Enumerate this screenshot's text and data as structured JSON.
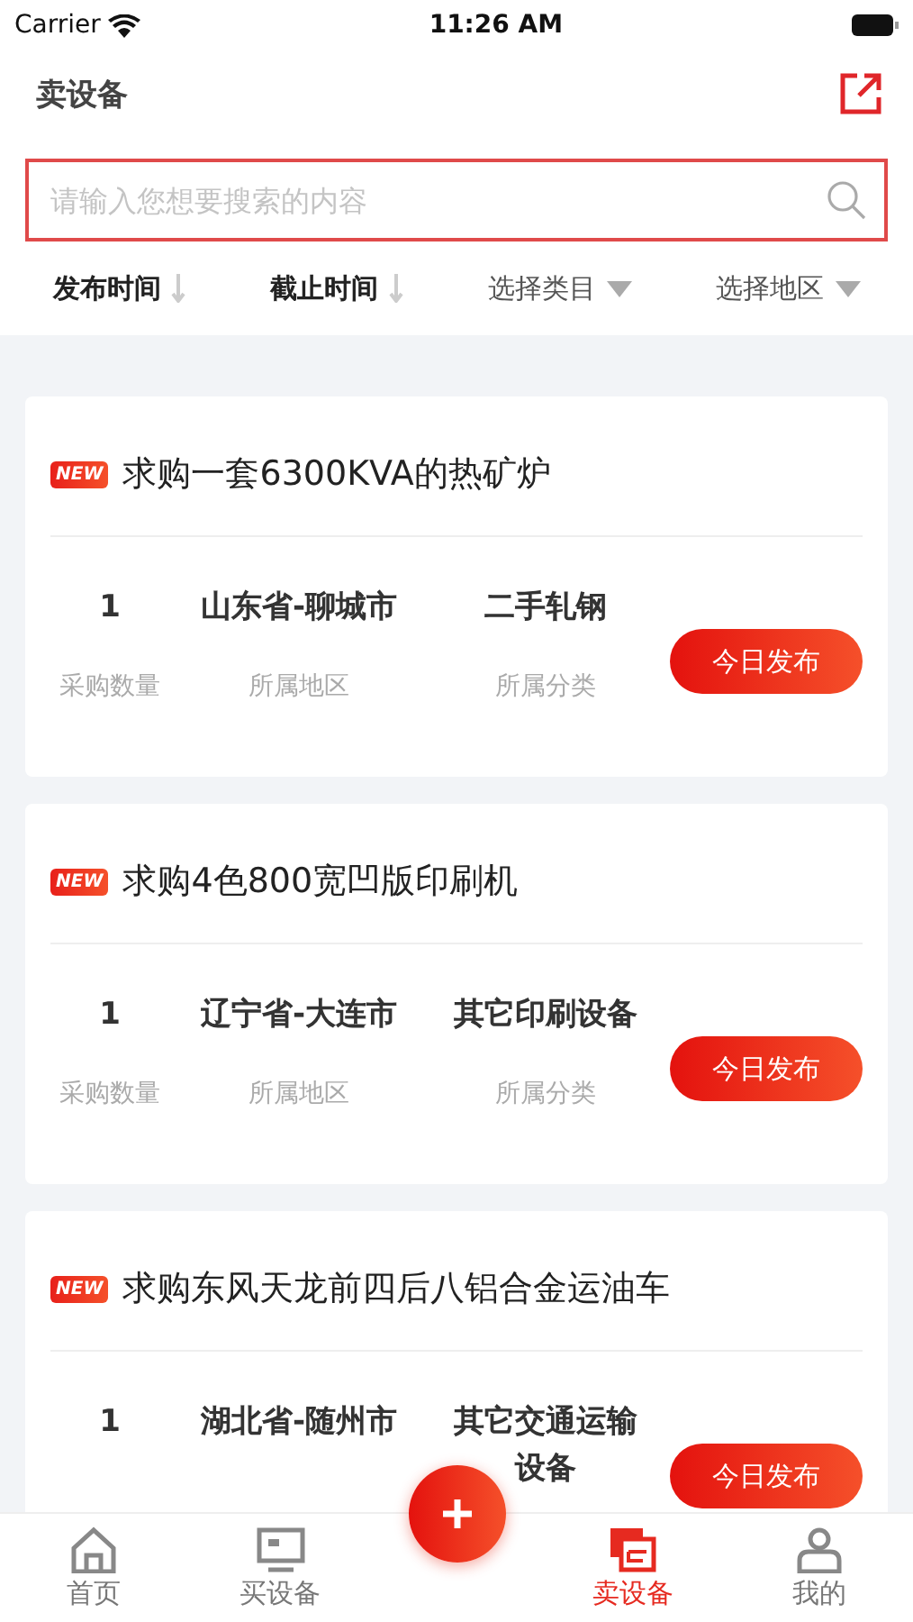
{
  "status_bar": {
    "carrier": "Carrier",
    "time": "11:26 AM"
  },
  "header": {
    "title": "卖设备"
  },
  "search": {
    "placeholder": "请输入您想要搜索的内容"
  },
  "filters": [
    {
      "label": "发布时间",
      "kind": "sort"
    },
    {
      "label": "截止时间",
      "kind": "sort"
    },
    {
      "label": "选择类目",
      "kind": "select"
    },
    {
      "label": "选择地区",
      "kind": "select"
    }
  ],
  "cards": [
    {
      "badge": "NEW",
      "title": "求购一套6300KVA的热矿炉",
      "quantity": "1",
      "region": "山东省-聊城市",
      "category": "二手轧钢",
      "labels": [
        "采购数量",
        "所属地区",
        "所属分类"
      ],
      "button": "今日发布"
    },
    {
      "badge": "NEW",
      "title": "求购4色800宽凹版印刷机",
      "quantity": "1",
      "region": "辽宁省-大连市",
      "category": "其它印刷设备",
      "labels": [
        "采购数量",
        "所属地区",
        "所属分类"
      ],
      "button": "今日发布"
    },
    {
      "badge": "NEW",
      "title": "求购东风天龙前四后八铝合金运油车",
      "quantity": "1",
      "region": "湖北省-随州市",
      "category": "其它交通运输设备",
      "button": "今日发布"
    }
  ],
  "tab_bar": [
    {
      "label": "首页",
      "selected": false
    },
    {
      "label": "买设备",
      "selected": false
    },
    {
      "label": "卖设备",
      "selected": true
    },
    {
      "label": "我的",
      "selected": false
    }
  ]
}
